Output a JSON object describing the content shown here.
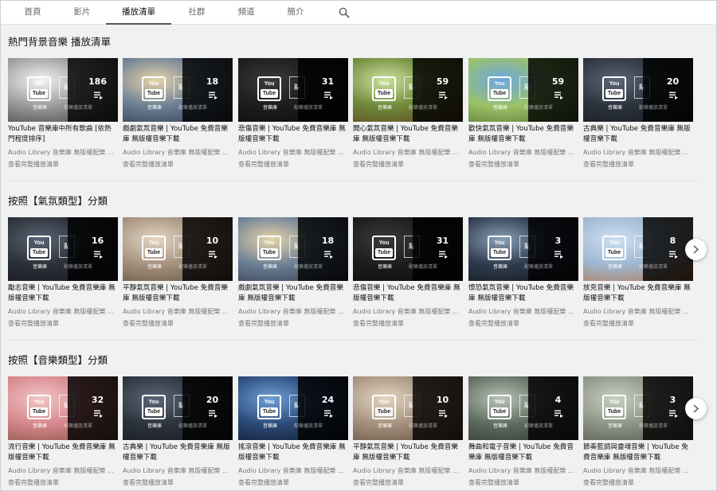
{
  "tabs": [
    {
      "label": "首頁",
      "active": false
    },
    {
      "label": "影片",
      "active": false
    },
    {
      "label": "播放清單",
      "active": true
    },
    {
      "label": "社群",
      "active": false
    },
    {
      "label": "頻道",
      "active": false
    },
    {
      "label": "簡介",
      "active": false
    }
  ],
  "search_icon": "search-icon",
  "common": {
    "channel": "Audio Library 音樂庫 無版權配樂 ...",
    "view_all": "查看完整播放清單",
    "yt_logo_top": "You",
    "yt_logo_bottom": "Tube",
    "yt_label": "音樂庫",
    "tag": "點",
    "overlay_sub": "配樂播放清單",
    "playlist_icon": "playlist-icon",
    "next_icon": "chevron-right-icon"
  },
  "sections": [
    {
      "title": "熱門背景音樂 播放清單",
      "has_next": false,
      "cards": [
        {
          "count": "186",
          "title": "YouTube 音樂庫中所有歌曲 [依熱門程度排序]",
          "palette": [
            "#f4f4f4",
            "#9a9a9a",
            "#3a3a3a"
          ]
        },
        {
          "count": "18",
          "title": "戲劇氣氛音樂 | YouTube 免費音樂庫 無版權音樂下載",
          "palette": [
            "#e8d4a8",
            "#6b7f96",
            "#2d3342"
          ]
        },
        {
          "count": "31",
          "title": "悲傷音樂 | YouTube 免費音樂庫 無版權音樂下載",
          "palette": [
            "#3a3a3a",
            "#1c1c1c",
            "#0c0c0c"
          ]
        },
        {
          "count": "59",
          "title": "開心氣氛音樂 | YouTube 免費音樂庫 無版權音樂下載",
          "palette": [
            "#cde2a0",
            "#6f8a3a",
            "#5e3b22"
          ]
        },
        {
          "count": "59",
          "title": "歡快氣氛音樂 | YouTube 免費音樂庫 無版權音樂下載",
          "palette": [
            "#6da6e3",
            "#9bc268",
            "#4f6b2b"
          ]
        },
        {
          "count": "20",
          "title": "古典樂 | YouTube 免費音樂庫 無版權音樂下載",
          "palette": [
            "#5b6777",
            "#2c333d",
            "#141820"
          ]
        }
      ]
    },
    {
      "title": "按照【氣氛類型】分類",
      "has_next": true,
      "cards": [
        {
          "count": "16",
          "title": "勵志音樂 | YouTube 免費音樂庫 無版權音樂下載",
          "palette": [
            "#5a6472",
            "#2b3038",
            "#131519"
          ]
        },
        {
          "count": "10",
          "title": "平靜氣氛音樂 | YouTube 免費音樂庫 無版權音樂下載",
          "palette": [
            "#e3d6c4",
            "#a4907c",
            "#5c4a3c"
          ]
        },
        {
          "count": "18",
          "title": "戲劇氣氛音樂 | YouTube 免費音樂庫 無版權音樂下載",
          "palette": [
            "#e8d4a8",
            "#6b7f96",
            "#2d3342"
          ]
        },
        {
          "count": "31",
          "title": "悲傷音樂 | YouTube 免費音樂庫 無版權音樂下載",
          "palette": [
            "#3a3a3a",
            "#1c1c1c",
            "#0c0c0c"
          ]
        },
        {
          "count": "3",
          "title": "懷恐氣氛音樂 | YouTube 免費音樂庫 無版權音樂下載",
          "palette": [
            "#8aa0b8",
            "#2e3a4c",
            "#0f141c"
          ]
        },
        {
          "count": "8",
          "title": "放克音樂 | YouTube 免費音樂庫 無版權音樂下載",
          "palette": [
            "#cfe0f2",
            "#9fb7d2",
            "#b56d3a"
          ]
        }
      ]
    },
    {
      "title": "按照【音樂類型】分類",
      "has_next": true,
      "cards": [
        {
          "count": "32",
          "title": "流行音樂 | YouTube 免費音樂庫 無版權音樂下載",
          "palette": [
            "#f1c6c6",
            "#d6868c",
            "#7a4d3a"
          ]
        },
        {
          "count": "20",
          "title": "古典樂 | YouTube 免費音樂庫 無版權音樂下載",
          "palette": [
            "#5b6777",
            "#2c333d",
            "#141820"
          ]
        },
        {
          "count": "24",
          "title": "搖滾音樂 | YouTube 免費音樂庫 無版權音樂下載",
          "palette": [
            "#6fa0d8",
            "#2b4a78",
            "#0e1524"
          ]
        },
        {
          "count": "10",
          "title": "平靜氣氛音樂 | YouTube 免費音樂庫 無版權音樂下載",
          "palette": [
            "#e3d6c4",
            "#a4907c",
            "#5c4a3c"
          ]
        },
        {
          "count": "4",
          "title": "舞曲和電子音樂 | YouTube 免費音樂庫 無版權音樂下載",
          "palette": [
            "#b8c4b8",
            "#5d6b5e",
            "#2a302a"
          ]
        },
        {
          "count": "3",
          "title": "節奏藍調與靈魂音樂 | YouTube 免費音樂庫 無版權音樂下載",
          "palette": [
            "#c9cfc2",
            "#8d9585",
            "#4b5048"
          ]
        }
      ]
    }
  ]
}
